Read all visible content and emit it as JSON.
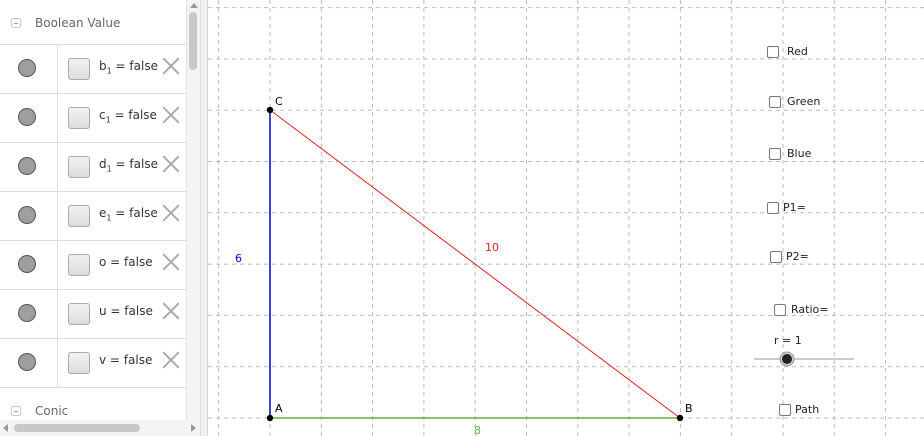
{
  "algebra": {
    "groups": {
      "boolean": "Boolean Value",
      "conic": "Conic"
    },
    "items": [
      {
        "name": "b",
        "sub": "1",
        "eq": " = false"
      },
      {
        "name": "c",
        "sub": "1",
        "eq": " = false"
      },
      {
        "name": "d",
        "sub": "1",
        "eq": " = false"
      },
      {
        "name": "e",
        "sub": "1",
        "eq": " = false"
      },
      {
        "name": "o",
        "sub": "",
        "eq": " = false"
      },
      {
        "name": "u",
        "sub": "",
        "eq": " = false"
      },
      {
        "name": "v",
        "sub": "",
        "eq": " = false"
      }
    ]
  },
  "graphics": {
    "points": {
      "a": "A",
      "b": "B",
      "c": "C"
    },
    "lengths": {
      "ab": "8",
      "ac": "6",
      "bc": "10"
    },
    "colors": {
      "ab": "#6aaa3a",
      "ac": "#0000cc",
      "bc": "#dd2222"
    },
    "checkboxes": {
      "red": "Red",
      "green": "Green",
      "blue": "Blue",
      "p1": "P1=",
      "p2": "P2=",
      "ratio": "Ratio=",
      "path": "Path"
    },
    "slider": {
      "label": "r = 1",
      "value": 1
    }
  }
}
